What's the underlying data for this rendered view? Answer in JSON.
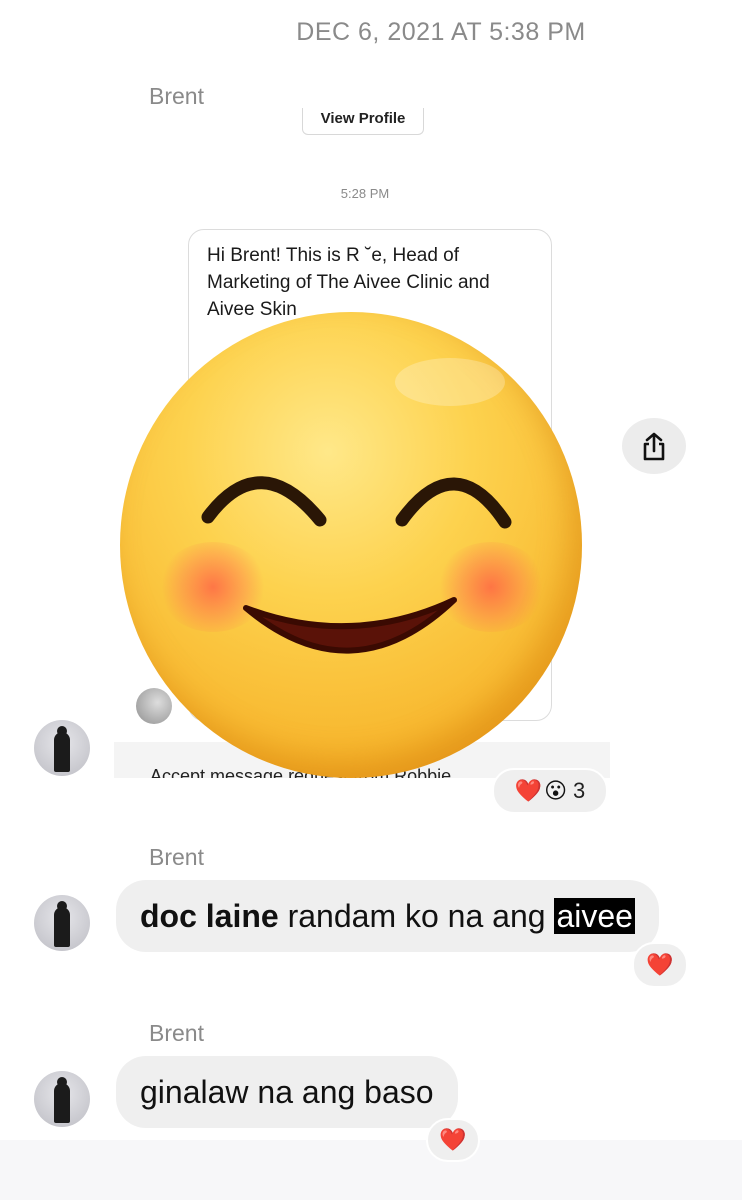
{
  "header": {
    "timestamp": "DEC 6, 2021 AT 5:38 PM"
  },
  "shared_post": {
    "sender": "Brent",
    "view_profile_label": "View Profile",
    "time": "5:28 PM",
    "message_lines": [
      "Hi Brent! This is R      ˘е, Head of",
      "Marketing of The Aivee Clinic and",
      "Aivee Skin"
    ],
    "accept_text": "Accept message request from Robbie",
    "reactions": {
      "emoji_1": "❤️",
      "emoji_2": "😮",
      "count": "3"
    }
  },
  "sticker": {
    "icon": "smiling-face-with-smiling-eyes-icon"
  },
  "messages": [
    {
      "sender": "Brent",
      "bold": "doc laine",
      "text": " randam ko na ang ",
      "highlight": "aivee",
      "reaction": "❤️"
    },
    {
      "sender": "Brent",
      "text": "ginalaw na ang baso",
      "reaction": "❤️"
    }
  ],
  "colors": {
    "bubble": "#efefef",
    "muted_text": "#8a8a8a",
    "highlight": "#000000"
  }
}
